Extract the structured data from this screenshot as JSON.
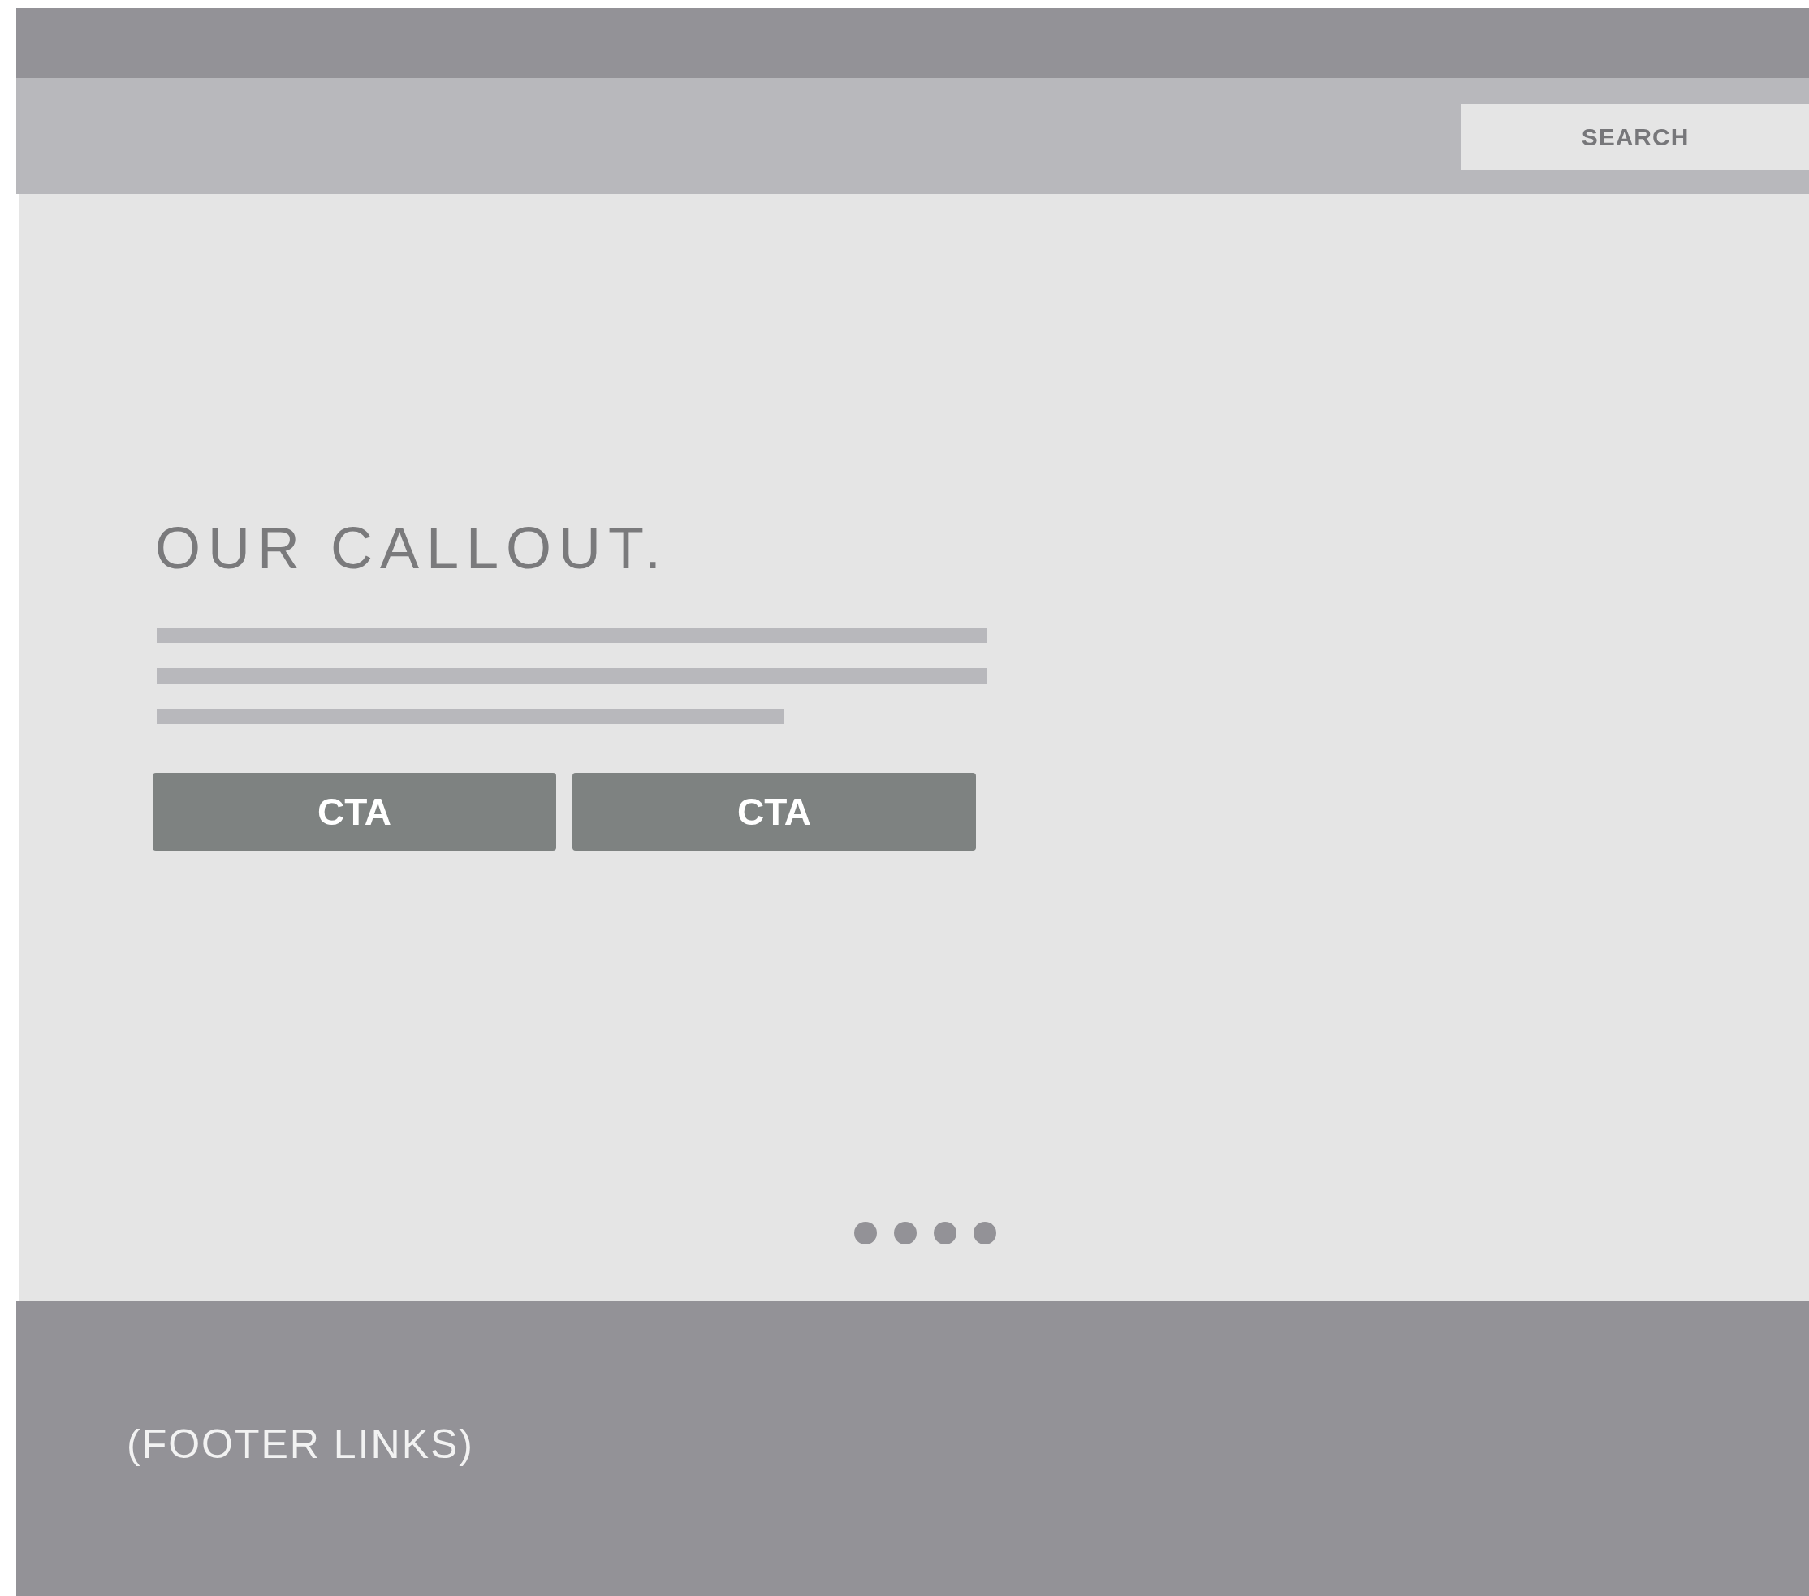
{
  "header": {
    "search": {
      "label": "SEARCH"
    }
  },
  "hero": {
    "title": "OUR CALLOUT.",
    "buttons": [
      {
        "label": "CTA"
      },
      {
        "label": "CTA"
      }
    ],
    "carousel_dots": [
      {
        "selected": false
      },
      {
        "selected": false
      },
      {
        "selected": false
      },
      {
        "selected": false
      }
    ]
  },
  "footer": {
    "text": "(FOOTER LINKS)"
  }
}
